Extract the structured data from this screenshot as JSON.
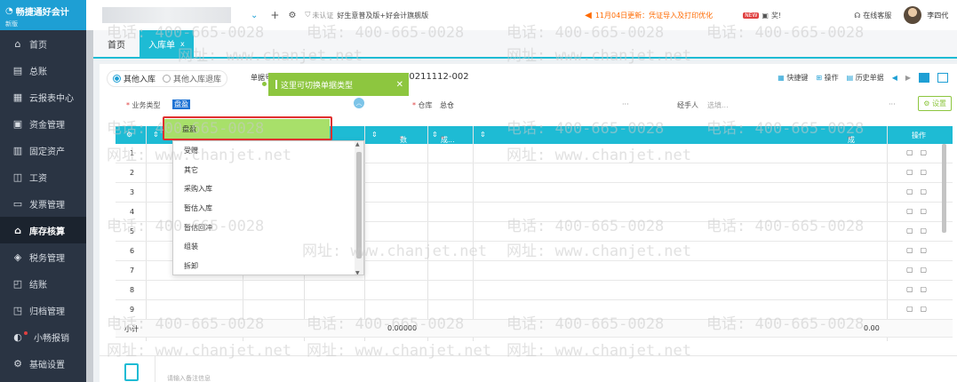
{
  "app": {
    "logo_name": "畅捷通好会计",
    "logo_sub": "新版"
  },
  "sidebar": {
    "items": [
      {
        "label": "首页",
        "icon": "home-icon"
      },
      {
        "label": "总账",
        "icon": "ledger-icon"
      },
      {
        "label": "云报表中心",
        "icon": "chart-icon"
      },
      {
        "label": "资金管理",
        "icon": "money-icon"
      },
      {
        "label": "固定资产",
        "icon": "asset-icon"
      },
      {
        "label": "工资",
        "icon": "salary-icon"
      },
      {
        "label": "发票管理",
        "icon": "invoice-icon"
      },
      {
        "label": "库存核算",
        "icon": "inventory-icon",
        "active": true
      },
      {
        "label": "税务管理",
        "icon": "tax-icon"
      },
      {
        "label": "结账",
        "icon": "checkout-icon"
      },
      {
        "label": "归档管理",
        "icon": "archive-icon"
      },
      {
        "label": "小畅报销",
        "icon": "reimburse-icon"
      },
      {
        "label": "基础设置",
        "icon": "gear-icon"
      }
    ]
  },
  "topbar": {
    "auth_status": "未认证",
    "product": "好生意普及版+好会计旗舰版",
    "notice": "11月04日更新：凭证导入及打印优化",
    "gift_badge": "NEW",
    "gift_label": "奖!",
    "service": "在线客服",
    "user": "李四代"
  },
  "tabs": {
    "home": "首页",
    "active": "入库单",
    "close": "x"
  },
  "form": {
    "radio_1": "其他入库",
    "radio_2": "其他入库退库",
    "bill_label": "单据号",
    "bill_no": "20211112-002",
    "tooltip": "这里可切换单据类型",
    "toolbar": {
      "shortcut": "快捷键",
      "operate": "操作",
      "history": "历史单据"
    },
    "business_type_label": "业务类型",
    "business_type_value": "盘盈",
    "warehouse_label": "仓库",
    "warehouse_value": "总仓",
    "handler_label": "经手人",
    "handler_placeholder": "选填...",
    "ellipsis": "···",
    "setting": "设置"
  },
  "table": {
    "headers": {
      "qty": "数量",
      "cost": "成...",
      "cost_amount": "成本金额",
      "ops": "操作"
    },
    "rows": [
      "1",
      "2",
      "3",
      "4",
      "5",
      "6",
      "7",
      "8",
      "9"
    ],
    "subtotal_label": "小计",
    "subtotal_qty": "0.00000",
    "subtotal_amount": "0.00"
  },
  "dropdown": {
    "options": [
      "盘盈",
      "受赠",
      "其它",
      "采购入库",
      "暂估入库",
      "暂估回冲",
      "组装",
      "拆卸"
    ],
    "selected": "盘盈"
  },
  "remark": {
    "placeholder": "请输入备注信息"
  },
  "watermark": {
    "phone": "电话: 400-665-0028",
    "site": "网址: www.chanjet.net"
  }
}
